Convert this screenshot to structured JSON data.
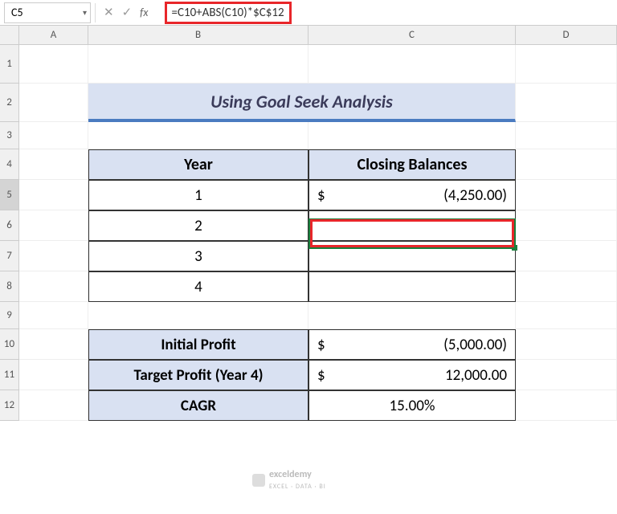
{
  "nameBox": "C5",
  "formula": "=C10+ABS(C10)*$C$12",
  "cols": {
    "A": "A",
    "B": "B",
    "C": "C",
    "D": "D"
  },
  "rows": {
    "r1": "1",
    "r2": "2",
    "r3": "3",
    "r4": "4",
    "r5": "5",
    "r6": "6",
    "r7": "7",
    "r8": "8",
    "r9": "9",
    "r10": "10",
    "r11": "11",
    "r12": "12"
  },
  "title": "Using Goal Seek Analysis",
  "headers": {
    "year": "Year",
    "closing": "Closing Balances"
  },
  "years": {
    "y1": "1",
    "y2": "2",
    "y3": "3",
    "y4": "4"
  },
  "c5": {
    "sym": "$",
    "val": "(4,250.00)"
  },
  "labels": {
    "initial": "Initial Profit",
    "target": "Target Profit (Year 4)",
    "cagr": "CAGR"
  },
  "values": {
    "initial": {
      "sym": "$",
      "val": "(5,000.00)"
    },
    "target": {
      "sym": "$",
      "val": "12,000.00"
    },
    "cagr": "15.00%"
  },
  "watermark": {
    "brand": "exceldemy",
    "sub": "EXCEL · DATA · BI"
  }
}
